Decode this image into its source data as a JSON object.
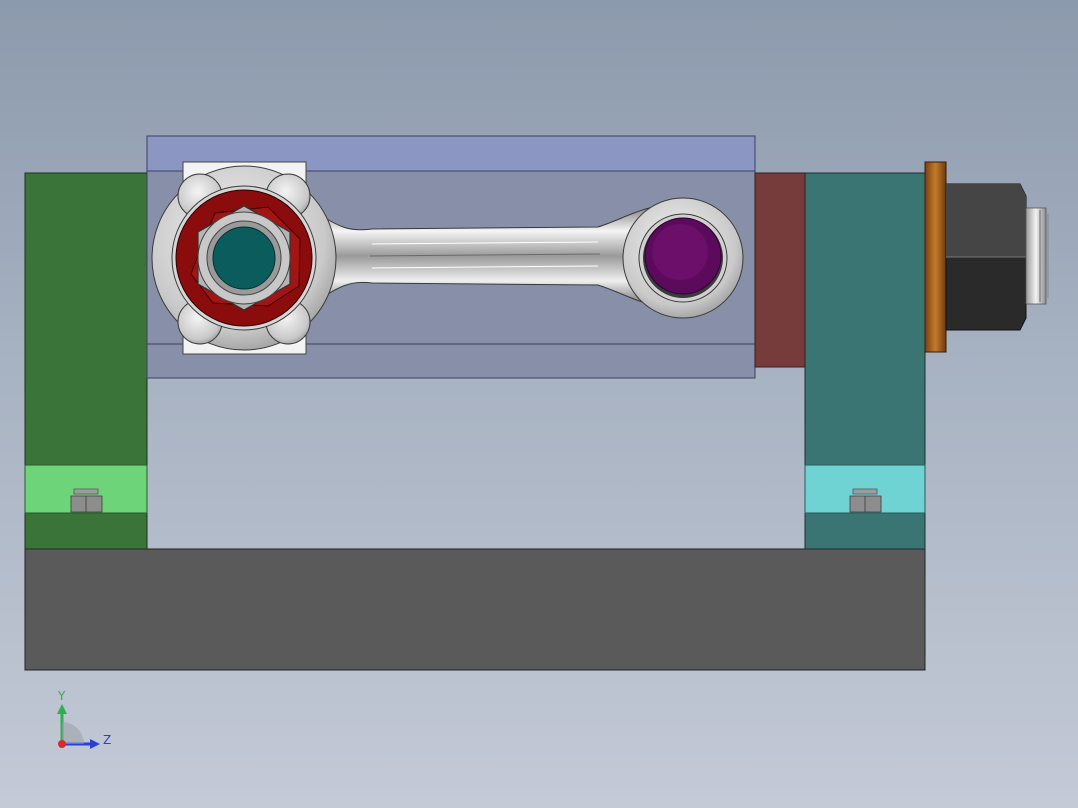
{
  "viewport": {
    "background_top": "#8c9aad",
    "background_bottom": "#c4cad6"
  },
  "triad": {
    "y_label": "Y",
    "z_label": "Z",
    "y_color": "#2bb24c",
    "z_color": "#2a3fd8",
    "x_color": "#d82a2a"
  },
  "colors": {
    "base_plate": "#5a5a5a",
    "left_support": "#3b7439",
    "left_support_slot": "#6dd47a",
    "right_support": "#3a7574",
    "right_support_slot": "#6fd3d3",
    "fixture_block_top": "#8c96c2",
    "fixture_block_face": "#8790a8",
    "spacer_plate": "#763b3b",
    "clamp_nut_washer": "#a8651e",
    "clamp_nut": "#3d3d3d",
    "big_end_ring": "#8b0c0c",
    "big_end_pin": "#0b5c5c",
    "small_end_pin": "#5c0a5c",
    "rod_body": "#d9d9d9"
  }
}
